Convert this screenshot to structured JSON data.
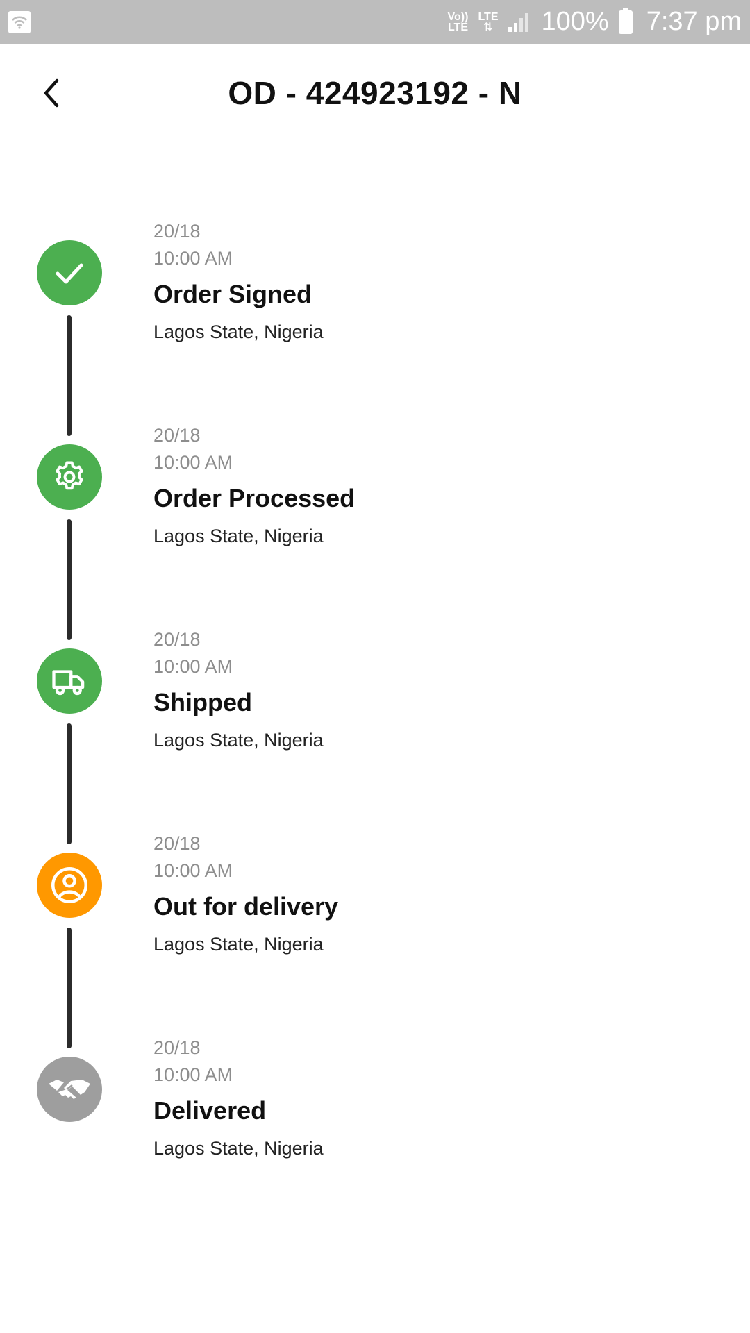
{
  "status_bar": {
    "volte_line1": "Vo))",
    "volte_line2": "LTE",
    "lte_label": "LTE",
    "battery_text": "100%",
    "time": "7:37 pm",
    "wifi_icon": "wifi-icon",
    "signal_icon": "signal-icon",
    "battery_icon": "battery-icon"
  },
  "header": {
    "back_icon": "chevron-left-icon",
    "title": "OD - 424923192 - N"
  },
  "colors": {
    "completed": "#4caf50",
    "current": "#ff9800",
    "pending": "#9e9e9e",
    "line": "#2b2b2b",
    "status_bar": "#bdbdbd"
  },
  "timeline": {
    "steps": [
      {
        "date": "20/18",
        "time": "10:00 AM",
        "title": "Order Signed",
        "location": "Lagos State, Nigeria",
        "icon": "check-icon",
        "state": "completed"
      },
      {
        "date": "20/18",
        "time": "10:00 AM",
        "title": "Order Processed",
        "location": "Lagos State, Nigeria",
        "icon": "gear-icon",
        "state": "completed"
      },
      {
        "date": "20/18",
        "time": "10:00 AM",
        "title": "Shipped",
        "location": "Lagos State, Nigeria",
        "icon": "truck-icon",
        "state": "completed"
      },
      {
        "date": "20/18",
        "time": "10:00 AM",
        "title": "Out for delivery",
        "location": "Lagos State, Nigeria",
        "icon": "user-icon",
        "state": "current"
      },
      {
        "date": "20/18",
        "time": "10:00 AM",
        "title": "Delivered",
        "location": "Lagos State, Nigeria",
        "icon": "handshake-icon",
        "state": "pending"
      }
    ]
  }
}
